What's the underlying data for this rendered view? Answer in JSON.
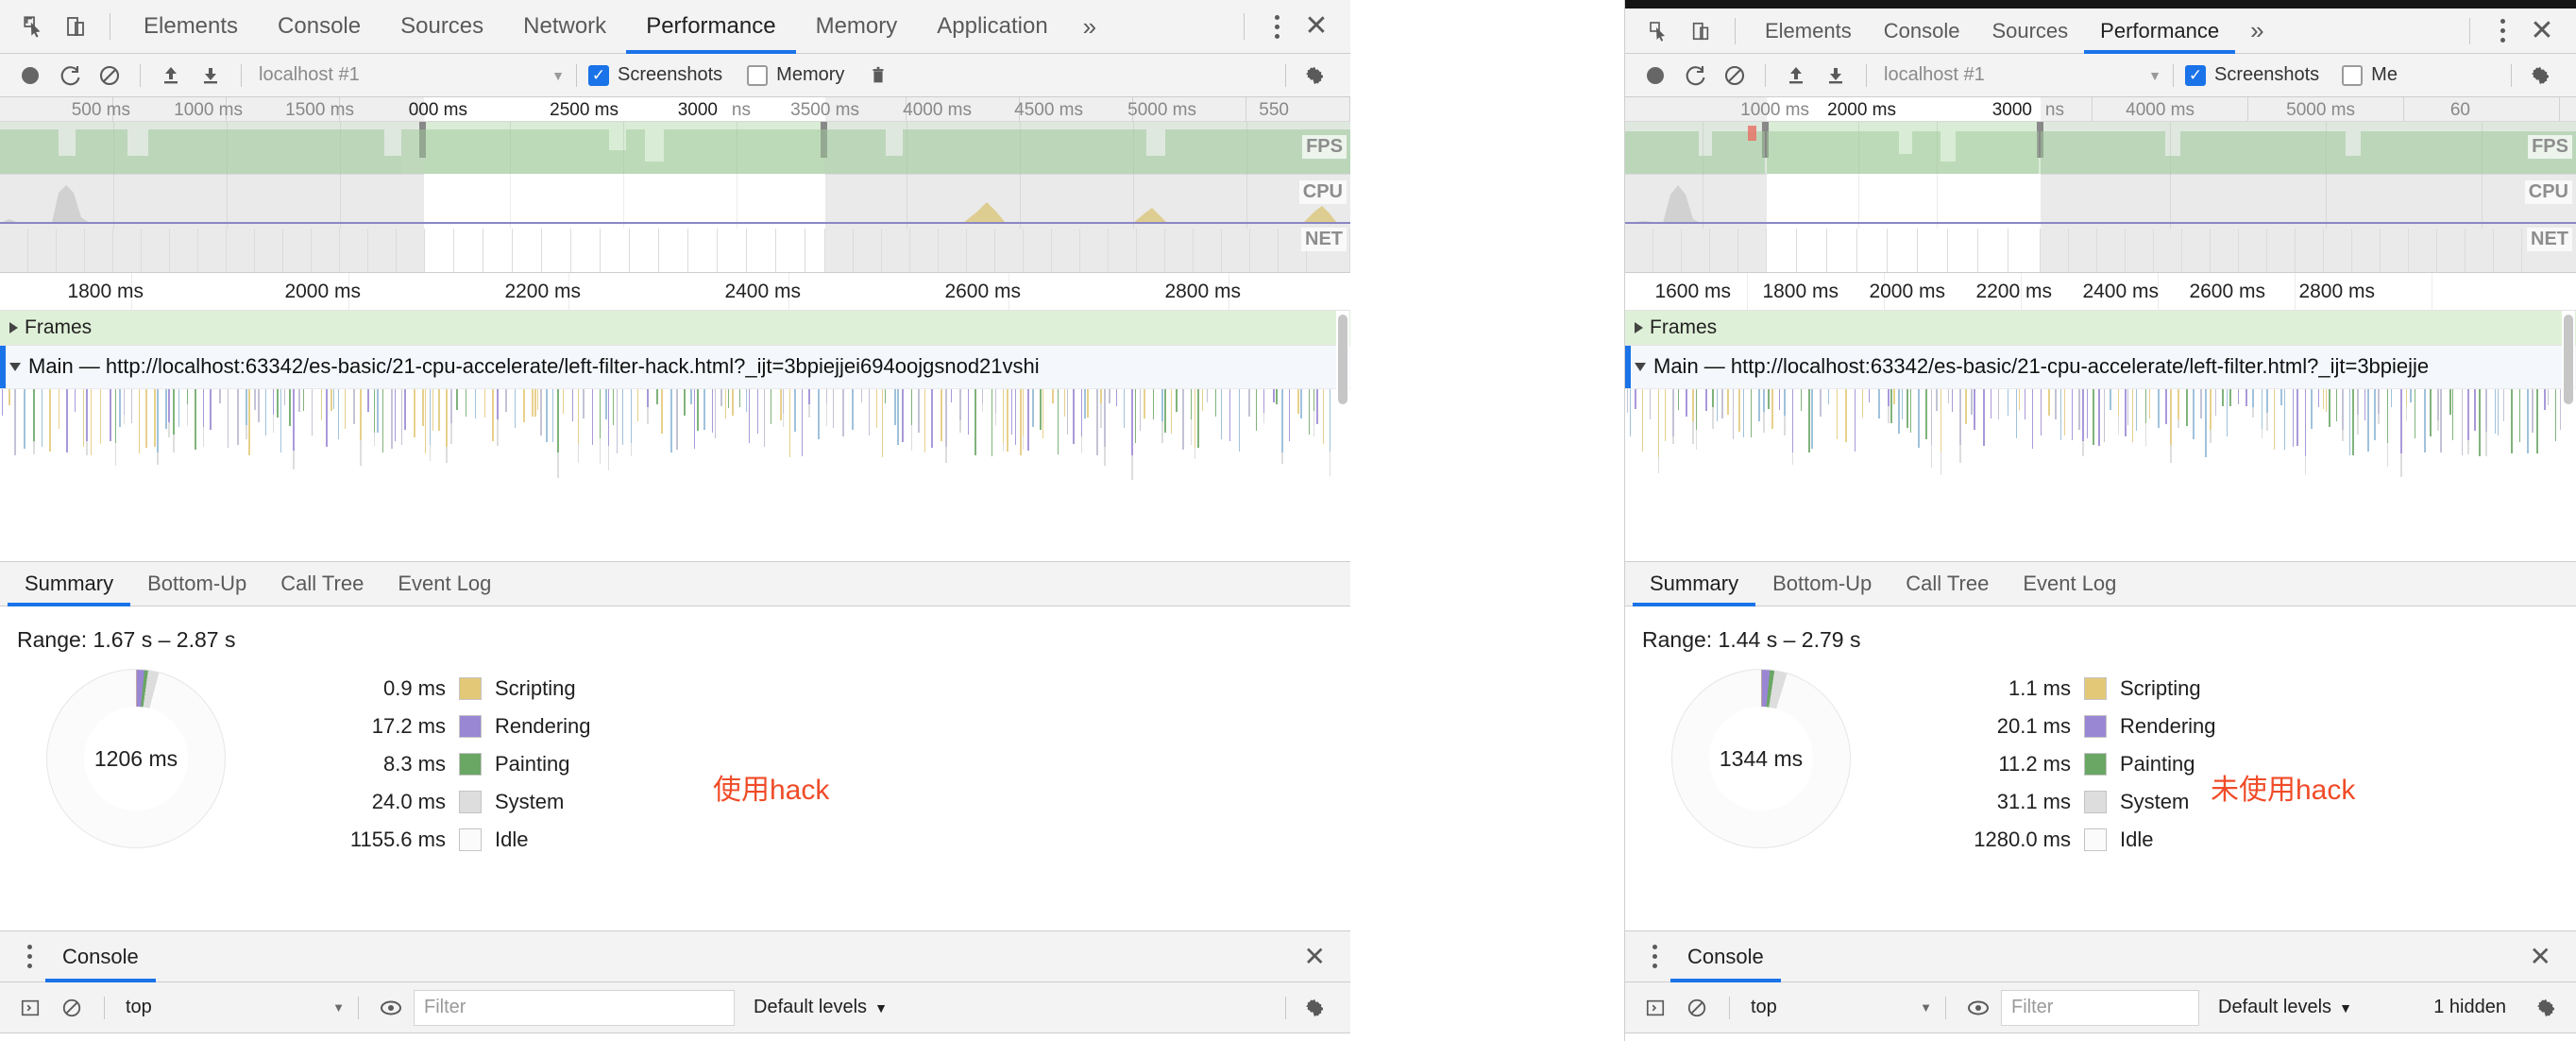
{
  "left": {
    "tabbar": {
      "inspect_icon": "inspect-cursor-icon",
      "device_icon": "device-toolbar-icon",
      "tabs": [
        {
          "label": "Elements",
          "active": false
        },
        {
          "label": "Console",
          "active": false
        },
        {
          "label": "Sources",
          "active": false
        },
        {
          "label": "Network",
          "active": false
        },
        {
          "label": "Performance",
          "active": true
        },
        {
          "label": "Memory",
          "active": false
        },
        {
          "label": "Application",
          "active": false
        }
      ],
      "more_label": "»",
      "menu_icon": "kebab-menu-icon",
      "close_label": "✕"
    },
    "controls": {
      "record_icon": "record-circle-icon",
      "reload_icon": "reload-record-icon",
      "clear_icon": "clear-icon",
      "load_icon": "load-profile-icon",
      "save_icon": "save-profile-icon",
      "session_value": "localhost #1",
      "session_arrow": "▼",
      "screenshots_label": "Screenshots",
      "screenshots_checked": true,
      "memory_label": "Memory",
      "memory_checked": false,
      "trash_icon": "trash-icon",
      "settings_icon": "gear-icon"
    },
    "overview_ruler": {
      "ticks": [
        "500 ms",
        "1000 ms",
        "1500 ms",
        "000 ms",
        "2500 ms",
        "3000",
        "ns",
        "3500 ms",
        "4000 ms",
        "4500 ms",
        "5000 ms",
        "550"
      ],
      "highlighted": [
        "000 ms",
        "2500 ms",
        "3000"
      ]
    },
    "overview": {
      "fps_label": "FPS",
      "cpu_label": "CPU",
      "net_label": "NET"
    },
    "detail_ruler": {
      "ticks": [
        "1800 ms",
        "2000 ms",
        "2200 ms",
        "2400 ms",
        "2600 ms",
        "2800 ms"
      ]
    },
    "tracks": {
      "frames_label": "Frames",
      "main_label": "Main — http://localhost:63342/es-basic/21-cpu-accelerate/left-filter-hack.html?_ijt=3bpiejjei694oojgsnod21vshi"
    },
    "bottom_tabs": [
      {
        "label": "Summary",
        "active": true
      },
      {
        "label": "Bottom-Up",
        "active": false
      },
      {
        "label": "Call Tree",
        "active": false
      },
      {
        "label": "Event Log",
        "active": false
      }
    ],
    "summary": {
      "range": "Range: 1.67 s – 2.87 s",
      "total": "1206 ms",
      "annotation": "使用hack",
      "annotation_color": "#f04b28"
    },
    "console": {
      "tab_label": "Console",
      "close_label": "✕",
      "sidebar_icon": "console-sidebar-icon",
      "clear_icon": "clear-console-icon",
      "context_value": "top",
      "context_arrow": "▼",
      "eye_icon": "live-expression-icon",
      "filter_placeholder": "Filter",
      "levels_label": "Default levels",
      "levels_arrow": "▼",
      "settings_icon": "gear-icon",
      "hidden_label": ""
    },
    "chart_data": {
      "type": "pie",
      "title": "Performance Summary — 使用hack",
      "center_label": "1206 ms",
      "total_ms": 1206,
      "range_label": "Range: 1.67 s – 2.87 s",
      "legend_position": "right",
      "categories": [
        "Scripting",
        "Rendering",
        "Painting",
        "System",
        "Idle"
      ],
      "values": [
        0.9,
        17.2,
        8.3,
        24.0,
        1155.6
      ],
      "value_labels": [
        "0.9 ms",
        "17.2 ms",
        "8.3 ms",
        "24.0 ms",
        "1155.6 ms"
      ],
      "colors": [
        "#e3c878",
        "#9a87d4",
        "#6aa664",
        "#dddddd",
        "#fbfbfb"
      ],
      "unit": "ms"
    }
  },
  "right": {
    "tabbar": {
      "inspect_icon": "inspect-cursor-icon",
      "device_icon": "device-toolbar-icon",
      "tabs": [
        {
          "label": "Elements",
          "active": false
        },
        {
          "label": "Console",
          "active": false
        },
        {
          "label": "Sources",
          "active": false
        },
        {
          "label": "Performance",
          "active": true
        }
      ],
      "more_label": "»",
      "menu_icon": "kebab-menu-icon",
      "close_label": "✕"
    },
    "controls": {
      "session_value": "localhost #1",
      "session_arrow": "▼",
      "screenshots_label": "Screenshots",
      "screenshots_checked": true,
      "memory_label": "Me",
      "memory_checked": false,
      "settings_icon": "gear-icon"
    },
    "overview_ruler": {
      "ticks": [
        "1000 ms",
        "2000 ms",
        "3000",
        "ns",
        "4000 ms",
        "5000 ms",
        "60"
      ],
      "highlighted": [
        "2000 ms",
        "3000"
      ]
    },
    "overview": {
      "fps_label": "FPS",
      "cpu_label": "CPU",
      "net_label": "NET"
    },
    "detail_ruler": {
      "ticks": [
        "1600 ms",
        "1800 ms",
        "2000 ms",
        "2200 ms",
        "2400 ms",
        "2600 ms",
        "2800 ms"
      ]
    },
    "tracks": {
      "frames_label": "Frames",
      "main_label": "Main — http://localhost:63342/es-basic/21-cpu-accelerate/left-filter.html?_ijt=3bpiejje"
    },
    "bottom_tabs": [
      {
        "label": "Summary",
        "active": true
      },
      {
        "label": "Bottom-Up",
        "active": false
      },
      {
        "label": "Call Tree",
        "active": false
      },
      {
        "label": "Event Log",
        "active": false
      }
    ],
    "summary": {
      "range": "Range: 1.44 s – 2.79 s",
      "total": "1344 ms",
      "annotation": "未使用hack",
      "annotation_color": "#f04b28"
    },
    "console": {
      "tab_label": "Console",
      "close_label": "✕",
      "context_value": "top",
      "context_arrow": "▼",
      "filter_placeholder": "Filter",
      "levels_label": "Default levels",
      "levels_arrow": "▼",
      "hidden_label": "1 hidden",
      "settings_icon": "gear-icon"
    },
    "chart_data": {
      "type": "pie",
      "title": "Performance Summary — 未使用hack",
      "center_label": "1344 ms",
      "total_ms": 1344,
      "range_label": "Range: 1.44 s – 2.79 s",
      "legend_position": "right",
      "categories": [
        "Scripting",
        "Rendering",
        "Painting",
        "System",
        "Idle"
      ],
      "values": [
        1.1,
        20.1,
        11.2,
        31.1,
        1280.0
      ],
      "value_labels": [
        "1.1 ms",
        "20.1 ms",
        "11.2 ms",
        "31.1 ms",
        "1280.0 ms"
      ],
      "colors": [
        "#e3c878",
        "#9a87d4",
        "#6aa664",
        "#dddddd",
        "#fbfbfb"
      ],
      "unit": "ms"
    }
  }
}
